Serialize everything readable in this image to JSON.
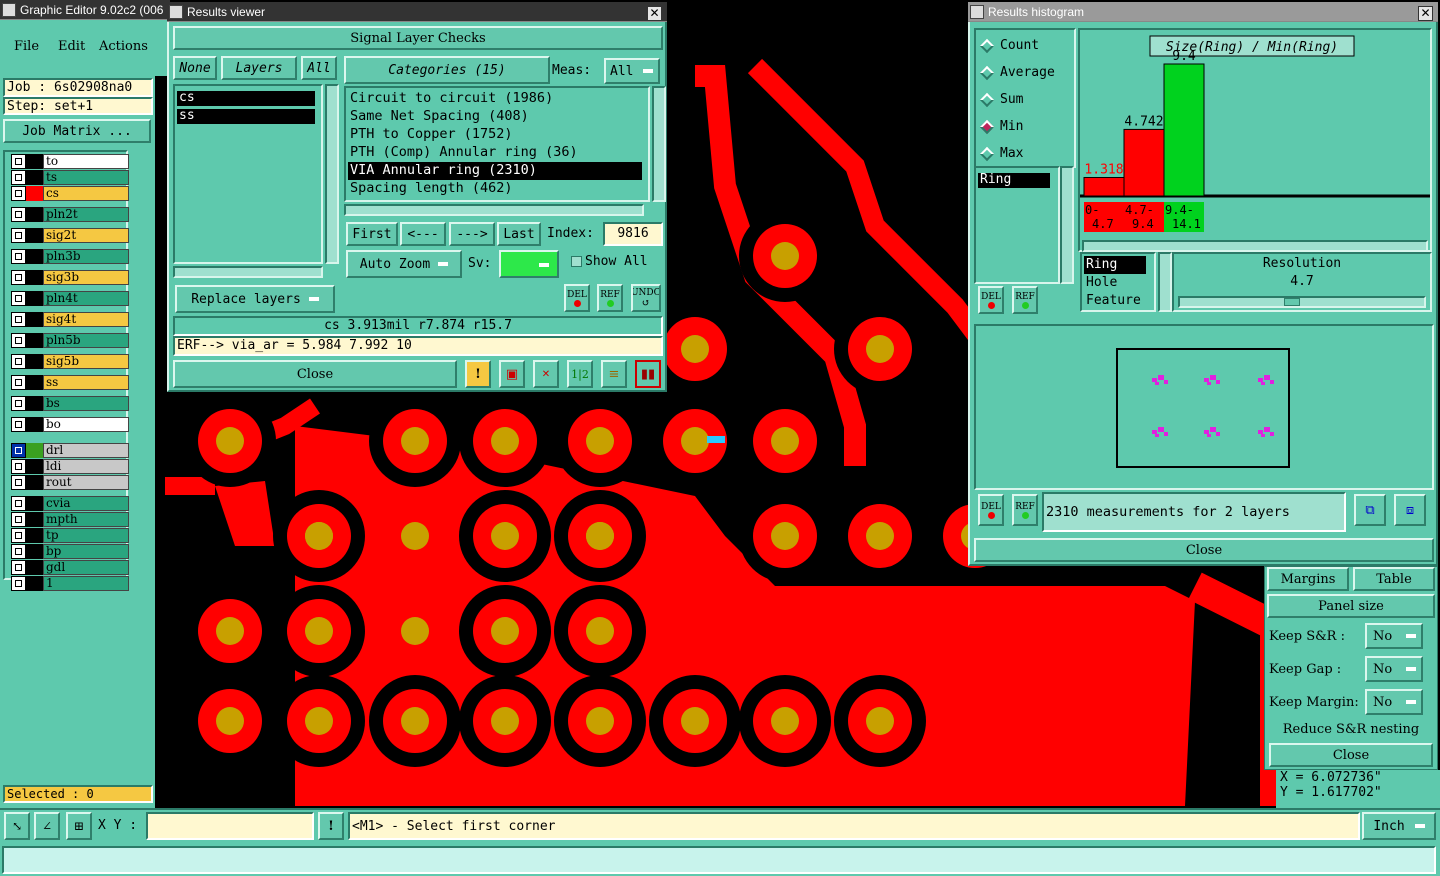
{
  "app": {
    "title": "Graphic Editor 9.02c2 (006",
    "menu": [
      "File",
      "Edit",
      "Actions"
    ],
    "job_label": "Job : 6s02908na0",
    "step_label": "Step: set+1",
    "job_matrix": "Job Matrix ...",
    "selected": "Selected : 0"
  },
  "layers": [
    {
      "name": "to",
      "color": "#ffffff",
      "swatch": "#000000"
    },
    {
      "name": "ts",
      "color": "#2aa57f",
      "swatch": "#000000"
    },
    {
      "name": "cs",
      "color": "#f5c842",
      "swatch": "#ff0000"
    },
    {
      "name": "pln2t",
      "color": "#2aa57f",
      "swatch": "#000000"
    },
    {
      "name": "sig2t",
      "color": "#f5c842",
      "swatch": "#000000"
    },
    {
      "name": "pln3b",
      "color": "#2aa57f",
      "swatch": "#000000"
    },
    {
      "name": "sig3b",
      "color": "#f5c842",
      "swatch": "#000000"
    },
    {
      "name": "pln4t",
      "color": "#2aa57f",
      "swatch": "#000000"
    },
    {
      "name": "sig4t",
      "color": "#f5c842",
      "swatch": "#000000"
    },
    {
      "name": "pln5b",
      "color": "#2aa57f",
      "swatch": "#000000"
    },
    {
      "name": "sig5b",
      "color": "#f5c842",
      "swatch": "#000000"
    },
    {
      "name": "ss",
      "color": "#f5c842",
      "swatch": "#000000"
    },
    {
      "name": "bs",
      "color": "#2aa57f",
      "swatch": "#000000"
    },
    {
      "name": "bo",
      "color": "#ffffff",
      "swatch": "#000000"
    },
    {
      "name": "drl",
      "color": "#c8c8c8",
      "swatch": "#3aa020"
    },
    {
      "name": "ldi",
      "color": "#c8c8c8",
      "swatch": "#000000"
    },
    {
      "name": "rout",
      "color": "#c8c8c8",
      "swatch": "#000000"
    },
    {
      "name": "cvia",
      "color": "#2aa57f",
      "swatch": "#000000"
    },
    {
      "name": "mpth",
      "color": "#2aa57f",
      "swatch": "#000000"
    },
    {
      "name": "tp",
      "color": "#2aa57f",
      "swatch": "#000000"
    },
    {
      "name": "bp",
      "color": "#2aa57f",
      "swatch": "#000000"
    },
    {
      "name": "gdl",
      "color": "#2aa57f",
      "swatch": "#000000"
    },
    {
      "name": "1",
      "color": "#2aa57f",
      "swatch": "#000000"
    }
  ],
  "viewer": {
    "title": "Results viewer",
    "header": "Signal Layer Checks",
    "tab_none": "None",
    "tab_layers": "Layers",
    "tab_all": "All",
    "categories_btn": "Categories (15)",
    "meas_label": "Meas:",
    "meas_value": "All",
    "layer_items": [
      "cs",
      "ss"
    ],
    "categories": [
      "Circuit to circuit (1986)",
      "Same Net Spacing (408)",
      "PTH to Copper (1752)",
      "PTH (Comp) Annular ring (36)",
      "VIA Annular ring (2310)",
      "Spacing length (462)"
    ],
    "selected_category": 4,
    "first": "First",
    "prev": "<---",
    "next": "--->",
    "last": "Last",
    "index_label": "Index:",
    "index_value": "9816",
    "auto_zoom": "Auto Zoom",
    "sv_label": "Sv:",
    "show_all": "Show All",
    "replace_layers": "Replace layers",
    "del": "DEL",
    "ref": "REF",
    "undo": "UNDO",
    "status": "cs 3.913mil  r7.874  r15.7",
    "erf": "ERF--> via_ar = 5.984 7.992 10",
    "close": "Close"
  },
  "histogram": {
    "title": "Results histogram",
    "modes": [
      "Count",
      "Average",
      "Sum",
      "Min",
      "Max"
    ],
    "selected_mode": "Min",
    "size_label": "Size(Ring) / Min(Ring)",
    "list_item": "Ring",
    "attrs": [
      "Ring",
      "Hole",
      "Feature"
    ],
    "resolution_label": "Resolution",
    "resolution_value": "4.7",
    "summary": "2310 measurements for 2 layers",
    "close": "Close",
    "del": "DEL",
    "ref": "REF"
  },
  "chart_data": {
    "type": "bar",
    "title": "Size(Ring) / Min(Ring)",
    "categories": [
      "0-4.7",
      "4.7-9.4",
      "9.4-14.1"
    ],
    "values": [
      1.318,
      4.742,
      9.4
    ],
    "colors": [
      "#ff0000",
      "#ff0000",
      "#00d21e"
    ],
    "ylim": [
      0,
      9.4
    ]
  },
  "panel": {
    "margins": "Margins",
    "table": "Table",
    "panel_size": "Panel size",
    "keep_sr": "Keep S&R  :",
    "keep_gap": "Keep Gap    :",
    "keep_margin": "Keep Margin:",
    "no": "No",
    "reduce": "Reduce S&R nesting",
    "close": "Close"
  },
  "coords": {
    "x": "X = 6.072736\"",
    "y": "Y = 1.617702\""
  },
  "bottom": {
    "xy_label": "X Y :",
    "prompt": "<M1> - Select first corner",
    "units": "Inch"
  }
}
